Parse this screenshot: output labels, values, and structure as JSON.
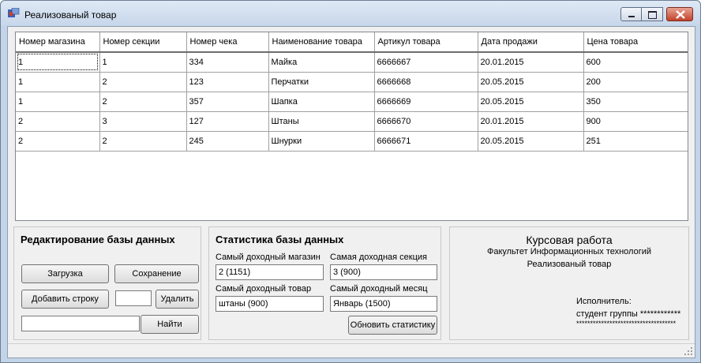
{
  "window": {
    "title": "Реализованый товар"
  },
  "grid": {
    "columns": [
      "Номер магазина",
      "Номер секции",
      "Номер чека",
      "Наименование товара",
      "Артикул товара",
      "Дата продажи",
      "Цена товара"
    ],
    "rows": [
      [
        "1",
        "1",
        "334",
        "Майка",
        "6666667",
        "20.01.2015",
        "600"
      ],
      [
        "1",
        "2",
        "123",
        "Перчатки",
        "6666668",
        "20.05.2015",
        "200"
      ],
      [
        "1",
        "2",
        "357",
        "Шапка",
        "6666669",
        "20.05.2015",
        "350"
      ],
      [
        "2",
        "3",
        "127",
        "Штаны",
        "6666670",
        "20.01.2015",
        "900"
      ],
      [
        "2",
        "2",
        "245",
        "Шнурки",
        "6666671",
        "20.05.2015",
        "251"
      ]
    ]
  },
  "edit": {
    "title": "Редактирование базы данных",
    "load_label": "Загрузка",
    "save_label": "Сохранение",
    "add_row_label": "Добавить строку",
    "delete_value": "",
    "delete_label": "Удалить",
    "find_value": "",
    "find_label": "Найти"
  },
  "stats": {
    "title": "Статистика базы данных",
    "top_store_label": "Самый доходный магазин",
    "top_store_value": "2 (1151)",
    "top_section_label": "Самая доходная секция",
    "top_section_value": "3 (900)",
    "top_product_label": "Самый доходный товар",
    "top_product_value": "штаны (900)",
    "top_month_label": "Самый доходный месяц",
    "top_month_value": "Январь (1500)",
    "refresh_label": "Обновить статистику"
  },
  "info": {
    "title": "Курсовая работа",
    "faculty": "Факультет Информационных технологий",
    "subject": "Реализованый товар",
    "author_label": "Исполнитель:",
    "group_label": "студент группы ************",
    "author_name": "************************************"
  },
  "colors": {
    "title_gradient_top": "#dfe9f5",
    "close_button": "#c2422a",
    "client_background": "#f0f0f0"
  }
}
